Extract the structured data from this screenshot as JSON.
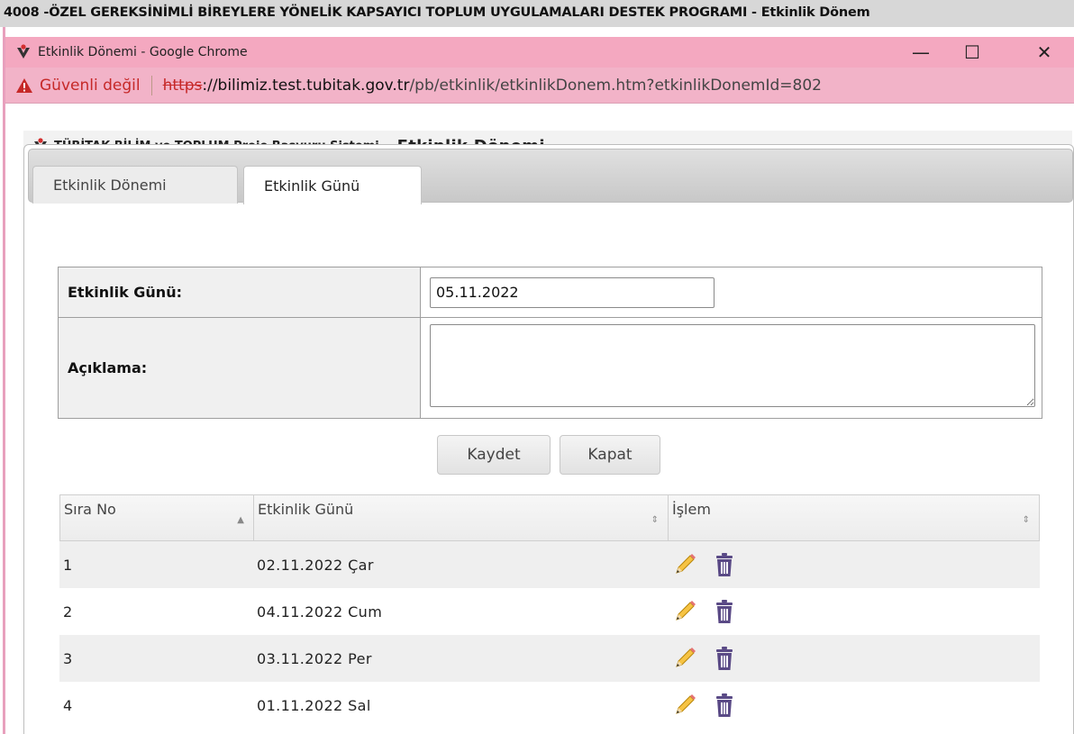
{
  "parent_window": {
    "title": "4008 -ÖZEL GEREKSİNİMLİ BİREYLERE YÖNELİK KAPSAYICI TOPLUM UYGULAMALARI DESTEK PROGRAMI - Etkinlik Dönem"
  },
  "popup": {
    "title": "Etkinlik Dönemi - Google Chrome",
    "minimize": "—",
    "maximize": "☐",
    "close": "✕",
    "security_label": "Güvenli değil",
    "url_scheme": "https",
    "url_host": "://bilimiz.test.tubitak.gov.tr",
    "url_path": "/pb/etkinlik/etkinlikDonem.htm?etkinlikDonemId=802"
  },
  "header": {
    "system_name": "TÜBİTAK BİLİM ve TOPLUM Proje Başvuru Sistemi -",
    "page_title": "Etkinlik Dönemi"
  },
  "tabs": [
    {
      "label": "Etkinlik Dönemi",
      "active": false
    },
    {
      "label": "Etkinlik Günü",
      "active": true
    }
  ],
  "form": {
    "date_label": "Etkinlik Günü:",
    "date_value": "05.11.2022",
    "desc_label": "Açıklama:",
    "desc_value": ""
  },
  "buttons": {
    "save": "Kaydet",
    "close": "Kapat"
  },
  "grid": {
    "columns": [
      "Sıra No",
      "Etkinlik Günü",
      "İşlem"
    ],
    "sort_asc": "▲",
    "sort_both": "⇕",
    "rows": [
      {
        "no": "1",
        "day": "02.11.2022 Çar"
      },
      {
        "no": "2",
        "day": "04.11.2022 Cum"
      },
      {
        "no": "3",
        "day": "03.11.2022 Per"
      },
      {
        "no": "4",
        "day": "01.11.2022 Sal"
      }
    ]
  },
  "colors": {
    "chrome_bar": "#f4a8c0",
    "address_bar": "#f2b3c8",
    "warning": "#c62828",
    "tubitak_red": "#d32f2f"
  },
  "icons": {
    "row_edit": "pencil-icon",
    "row_delete": "trash-icon",
    "warning": "warning-icon",
    "logo": "tubitak-logo-icon"
  }
}
